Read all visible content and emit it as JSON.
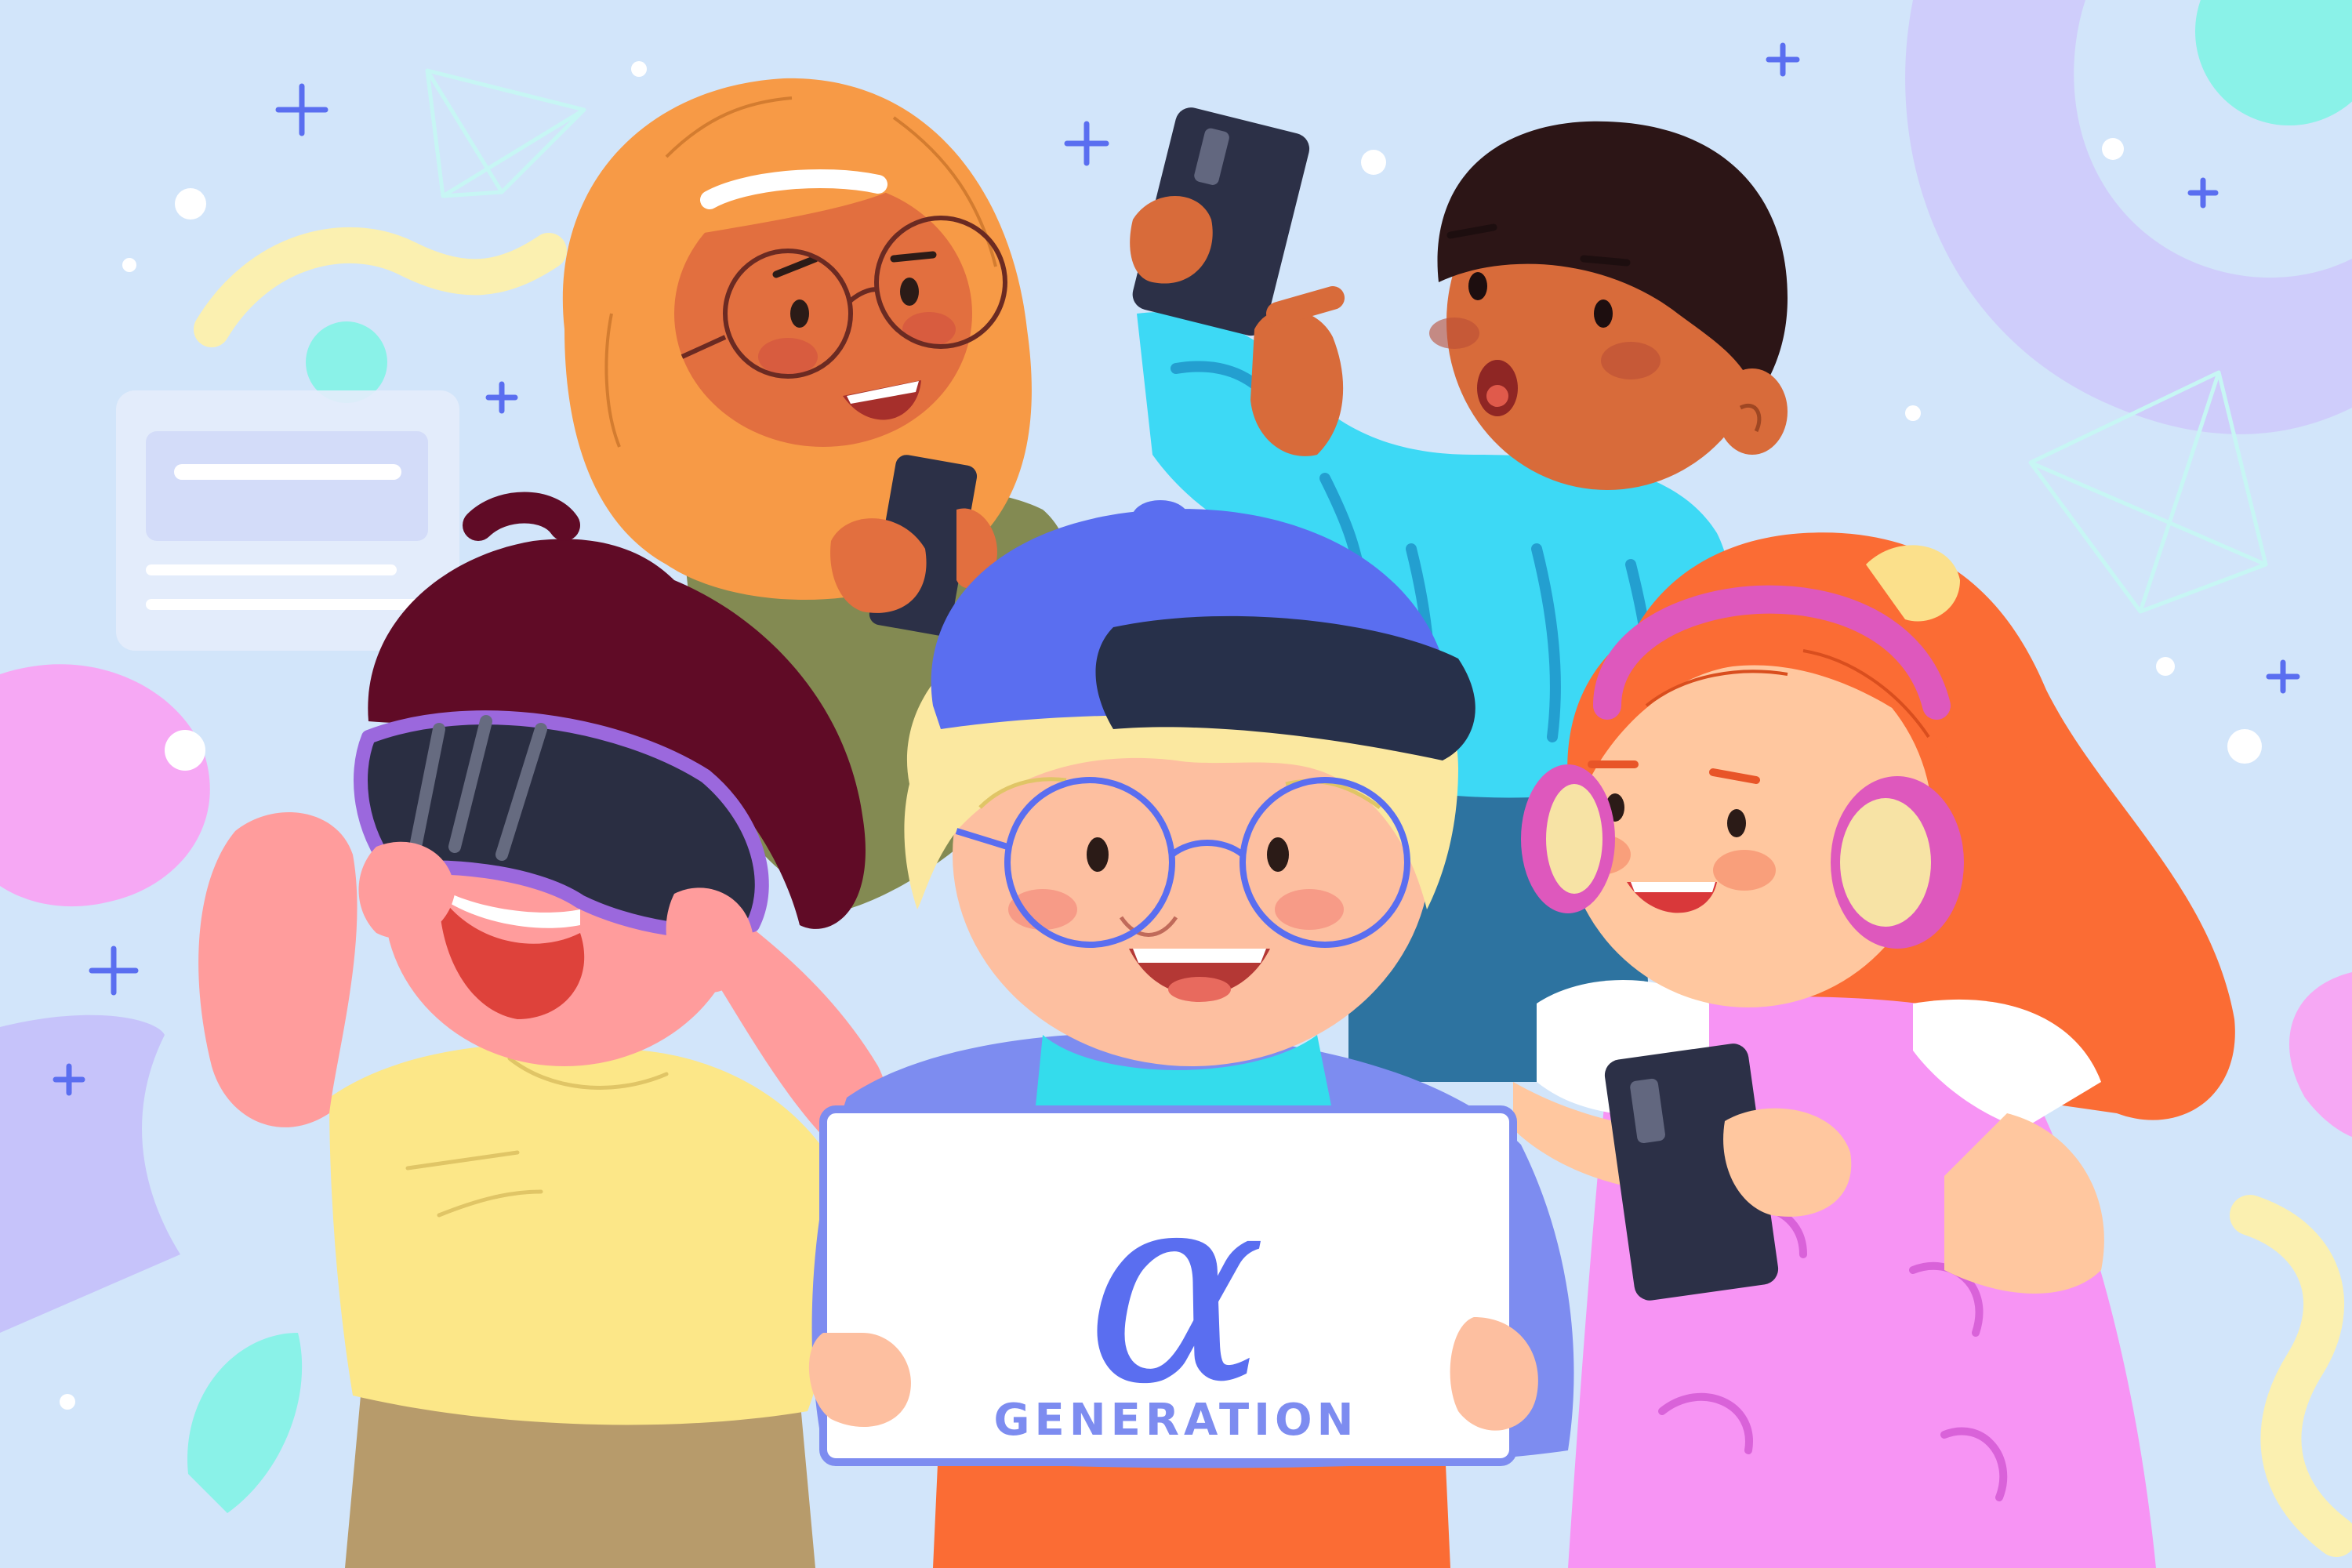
{
  "scene": {
    "background": "#d2e5fa",
    "accent": "#5a6ef0",
    "people_count": 5
  },
  "sign": {
    "symbol": "α",
    "caption": "GENERATION",
    "text_color": "#5a6ef0",
    "board_color": "#ffffff"
  },
  "icons": [
    "sparkle-plus-icon",
    "wireframe-gem-icon",
    "chat-card-icon",
    "smartphone-icon",
    "vr-headset-icon",
    "headphones-icon",
    "eyeglasses-icon"
  ]
}
